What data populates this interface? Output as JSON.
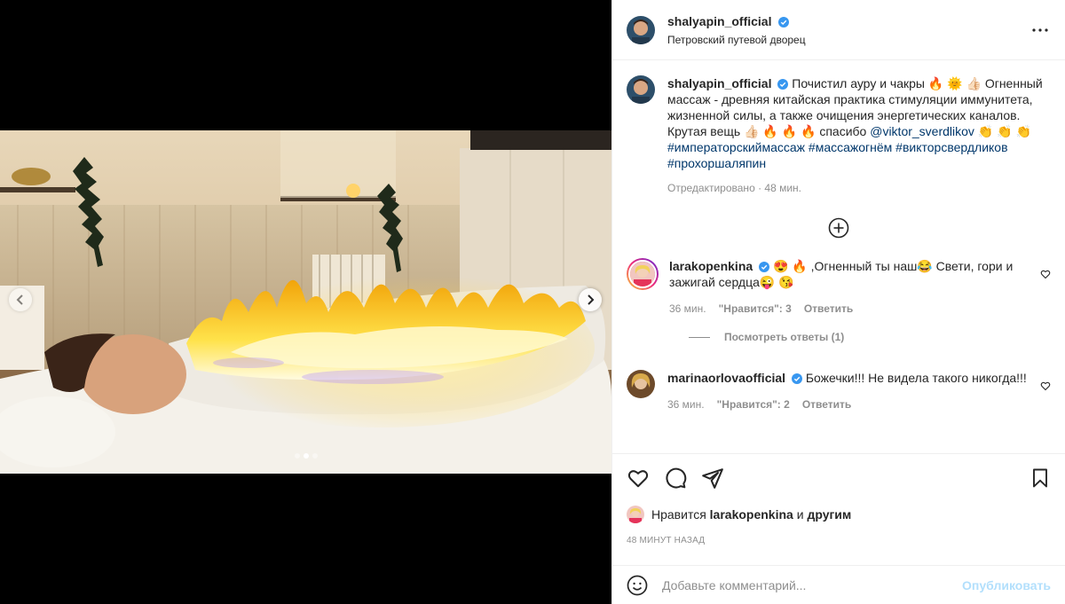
{
  "media": {
    "prev_icon": "chevron-left-icon",
    "next_icon": "chevron-right-icon",
    "carousel_count": 3,
    "carousel_active": 1
  },
  "header": {
    "username": "shalyapin_official",
    "location": "Петровский путевой дворец",
    "more_icon": "more-horizontal-icon"
  },
  "caption": {
    "username": "shalyapin_official",
    "line1": "Почистил ауру и чакры 🔥 🌞 👍🏻",
    "line2": "Огненный массаж - древняя китайская практика стимуляции иммунитета, жизненной силы, а также очищения энергетических каналов. Крутая вещь 👍🏻 🔥 🔥 🔥 спасибо",
    "mention": "@viktor_sverdlikov",
    "emojis": " 👏 👏 👏 ",
    "hashtags": "#императорскиймассаж #массажогнём #викторсвердликов #прохоршаляпин",
    "edited": "Отредактировано · 48 мин."
  },
  "comments": [
    {
      "username": "larakopenkina",
      "text": "😍 🔥 ,Огненный ты наш😂 Свети, гори и зажигай сердца😜 😘",
      "time": "36 мин.",
      "likes": "\"Нравится\": 3",
      "reply": "Ответить",
      "view_replies": "Посмотреть ответы (1)"
    },
    {
      "username": "marinaorlovaofficial",
      "text": "Божечки!!! Не видела такого никогда!!!",
      "time": "36 мин.",
      "likes": "\"Нравится\": 2",
      "reply": "Ответить"
    }
  ],
  "actions": {
    "liked_by_prefix": "Нравится ",
    "liked_by_user": "larakopenkina",
    "liked_by_mid": " и ",
    "liked_by_others": "другим",
    "timestamp": "48 МИНУТ НАЗАД"
  },
  "add_comment": {
    "placeholder": "Добавьте комментарий...",
    "publish": "Опубликовать",
    "emoji_icon": "smiley-icon"
  },
  "colors": {
    "verified": "#3897f0",
    "link": "#00376b",
    "publish_disabled": "#b2dffc"
  }
}
